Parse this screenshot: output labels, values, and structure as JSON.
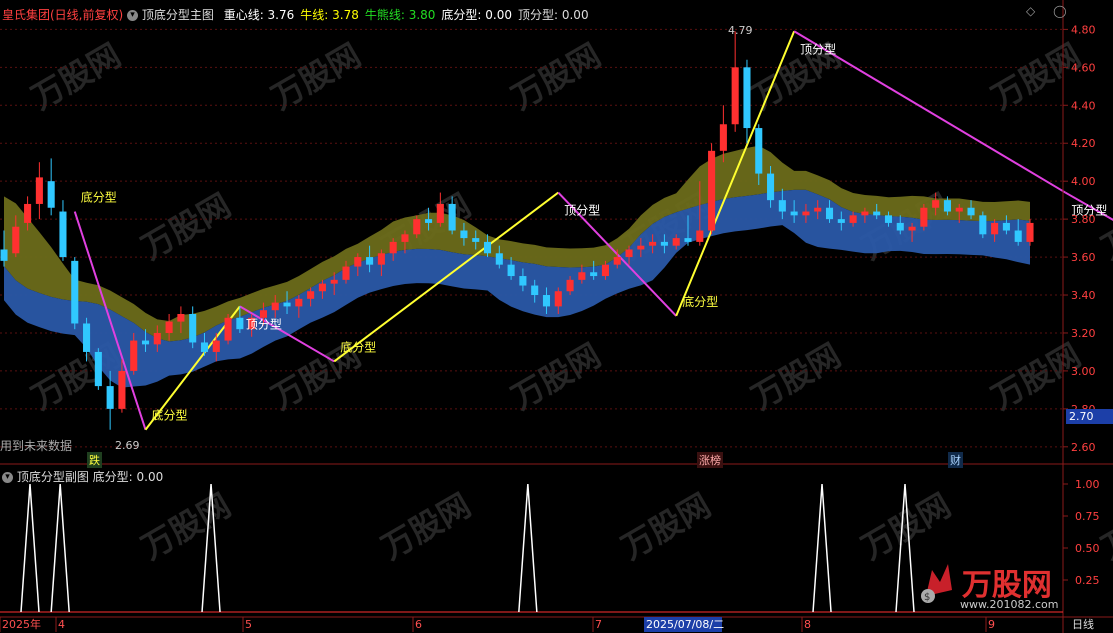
{
  "header": {
    "stock": "皇氏集团(日线,前复权)",
    "indicator": "顶底分型主图",
    "items": [
      {
        "label": "重心线:",
        "value": "3.76",
        "color": "#ffffff"
      },
      {
        "label": "牛线:",
        "value": "3.78",
        "color": "#ffff00"
      },
      {
        "label": "牛熊线:",
        "value": "3.80",
        "color": "#22dd22"
      },
      {
        "label": "底分型:",
        "value": "0.00",
        "color": "#ffffff"
      },
      {
        "label": "顶分型:",
        "value": "0.00",
        "color": "#dddddd"
      }
    ]
  },
  "sub_header": {
    "indicator": "顶底分型副图",
    "label": "底分型:",
    "value": "0.00"
  },
  "price_axis": {
    "ticks": [
      "4.80",
      "4.60",
      "4.40",
      "4.20",
      "4.00",
      "3.80",
      "3.60",
      "3.40",
      "3.20",
      "3.00",
      "2.80",
      "2.60"
    ],
    "current": "2.70"
  },
  "sub_axis": {
    "ticks": [
      "1.00",
      "0.75",
      "0.50",
      "0.25"
    ]
  },
  "time_axis": {
    "labels": [
      "2025年",
      "4",
      "5",
      "6",
      "7",
      "2025/07/08/二",
      "8",
      "9"
    ],
    "period": "日线"
  },
  "annotations": {
    "future_data": "用到未来数据",
    "low_price": "2.69",
    "high_price": "4.79",
    "top_label": "顶分型",
    "bottom_label": "底分型",
    "event_1": "跌",
    "event_2": "涨榜",
    "event_3": "财"
  },
  "watermark": "万股网",
  "watermark_url": "www.201082.com",
  "chart_data": {
    "type": "candlestick",
    "price_range": [
      2.52,
      4.86
    ],
    "ohlc": [
      [
        3.64,
        3.74,
        3.55,
        3.58
      ],
      [
        3.62,
        3.82,
        3.6,
        3.76
      ],
      [
        3.78,
        3.92,
        3.74,
        3.88
      ],
      [
        3.88,
        4.1,
        3.8,
        4.02
      ],
      [
        4.0,
        4.12,
        3.82,
        3.86
      ],
      [
        3.84,
        3.9,
        3.58,
        3.6
      ],
      [
        3.58,
        3.6,
        3.22,
        3.25
      ],
      [
        3.25,
        3.28,
        3.05,
        3.1
      ],
      [
        3.1,
        3.12,
        2.9,
        2.92
      ],
      [
        2.92,
        3.0,
        2.69,
        2.8
      ],
      [
        2.8,
        3.06,
        2.78,
        3.0
      ],
      [
        3.0,
        3.2,
        2.98,
        3.16
      ],
      [
        3.16,
        3.22,
        3.1,
        3.14
      ],
      [
        3.14,
        3.24,
        3.1,
        3.2
      ],
      [
        3.2,
        3.3,
        3.16,
        3.26
      ],
      [
        3.26,
        3.34,
        3.2,
        3.3
      ],
      [
        3.3,
        3.34,
        3.12,
        3.15
      ],
      [
        3.15,
        3.2,
        3.08,
        3.1
      ],
      [
        3.1,
        3.2,
        3.05,
        3.16
      ],
      [
        3.16,
        3.3,
        3.14,
        3.28
      ],
      [
        3.28,
        3.34,
        3.2,
        3.22
      ],
      [
        3.22,
        3.3,
        3.18,
        3.28
      ],
      [
        3.28,
        3.36,
        3.24,
        3.32
      ],
      [
        3.32,
        3.4,
        3.28,
        3.36
      ],
      [
        3.36,
        3.42,
        3.3,
        3.34
      ],
      [
        3.34,
        3.4,
        3.28,
        3.38
      ],
      [
        3.38,
        3.44,
        3.34,
        3.42
      ],
      [
        3.42,
        3.48,
        3.38,
        3.46
      ],
      [
        3.46,
        3.52,
        3.4,
        3.48
      ],
      [
        3.48,
        3.58,
        3.46,
        3.55
      ],
      [
        3.55,
        3.62,
        3.5,
        3.6
      ],
      [
        3.6,
        3.66,
        3.52,
        3.56
      ],
      [
        3.56,
        3.64,
        3.5,
        3.62
      ],
      [
        3.62,
        3.7,
        3.58,
        3.68
      ],
      [
        3.68,
        3.74,
        3.62,
        3.72
      ],
      [
        3.72,
        3.82,
        3.7,
        3.8
      ],
      [
        3.8,
        3.86,
        3.74,
        3.78
      ],
      [
        3.78,
        3.94,
        3.76,
        3.88
      ],
      [
        3.88,
        3.92,
        3.72,
        3.74
      ],
      [
        3.74,
        3.78,
        3.66,
        3.7
      ],
      [
        3.7,
        3.74,
        3.64,
        3.68
      ],
      [
        3.68,
        3.72,
        3.6,
        3.62
      ],
      [
        3.62,
        3.66,
        3.54,
        3.56
      ],
      [
        3.56,
        3.6,
        3.48,
        3.5
      ],
      [
        3.5,
        3.54,
        3.42,
        3.45
      ],
      [
        3.45,
        3.48,
        3.36,
        3.4
      ],
      [
        3.4,
        3.44,
        3.3,
        3.34
      ],
      [
        3.34,
        3.44,
        3.3,
        3.42
      ],
      [
        3.42,
        3.5,
        3.4,
        3.48
      ],
      [
        3.48,
        3.56,
        3.46,
        3.52
      ],
      [
        3.52,
        3.58,
        3.48,
        3.5
      ],
      [
        3.5,
        3.58,
        3.48,
        3.56
      ],
      [
        3.56,
        3.64,
        3.54,
        3.6
      ],
      [
        3.6,
        3.66,
        3.56,
        3.64
      ],
      [
        3.64,
        3.7,
        3.6,
        3.66
      ],
      [
        3.66,
        3.72,
        3.62,
        3.68
      ],
      [
        3.68,
        3.72,
        3.62,
        3.66
      ],
      [
        3.66,
        3.72,
        3.64,
        3.7
      ],
      [
        3.7,
        3.82,
        3.66,
        3.68
      ],
      [
        3.68,
        4.0,
        3.66,
        3.74
      ],
      [
        3.74,
        4.2,
        3.72,
        4.16
      ],
      [
        4.16,
        4.4,
        4.1,
        4.3
      ],
      [
        4.3,
        4.79,
        4.26,
        4.6
      ],
      [
        4.6,
        4.64,
        4.2,
        4.28
      ],
      [
        4.28,
        4.3,
        3.98,
        4.04
      ],
      [
        4.04,
        4.08,
        3.86,
        3.9
      ],
      [
        3.9,
        3.96,
        3.8,
        3.84
      ],
      [
        3.84,
        3.9,
        3.78,
        3.82
      ],
      [
        3.82,
        3.88,
        3.78,
        3.84
      ],
      [
        3.84,
        3.9,
        3.8,
        3.86
      ],
      [
        3.86,
        3.9,
        3.78,
        3.8
      ],
      [
        3.8,
        3.84,
        3.74,
        3.78
      ],
      [
        3.78,
        3.84,
        3.76,
        3.82
      ],
      [
        3.82,
        3.86,
        3.78,
        3.84
      ],
      [
        3.84,
        3.88,
        3.8,
        3.82
      ],
      [
        3.82,
        3.84,
        3.76,
        3.78
      ],
      [
        3.78,
        3.82,
        3.72,
        3.74
      ],
      [
        3.74,
        3.78,
        3.68,
        3.76
      ],
      [
        3.76,
        3.88,
        3.74,
        3.86
      ],
      [
        3.86,
        3.94,
        3.82,
        3.9
      ],
      [
        3.9,
        3.92,
        3.82,
        3.84
      ],
      [
        3.84,
        3.88,
        3.78,
        3.86
      ],
      [
        3.86,
        3.9,
        3.8,
        3.82
      ],
      [
        3.82,
        3.84,
        3.7,
        3.72
      ],
      [
        3.72,
        3.8,
        3.68,
        3.78
      ],
      [
        3.78,
        3.82,
        3.72,
        3.74
      ],
      [
        3.74,
        3.8,
        3.66,
        3.68
      ],
      [
        3.68,
        3.8,
        3.66,
        3.78
      ]
    ],
    "top_fractals": [
      [
        20,
        3.34
      ],
      [
        47,
        3.94
      ],
      [
        67,
        4.79
      ],
      [
        90,
        3.94
      ]
    ],
    "bottom_fractals": [
      [
        6,
        3.84
      ],
      [
        12,
        2.69
      ],
      [
        28,
        3.05
      ],
      [
        57,
        3.29
      ],
      [
        99,
        3.62
      ]
    ],
    "sub_signal": [
      10,
      14,
      34,
      76,
      115,
      126
    ]
  }
}
